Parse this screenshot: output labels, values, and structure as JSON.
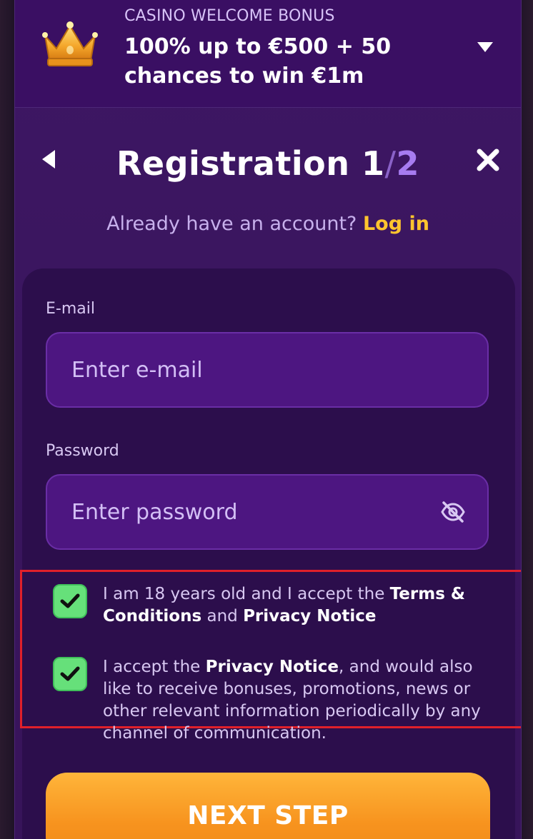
{
  "bonus": {
    "kicker": "CASINO WELCOME BONUS",
    "title": "100% up to €500 + 50 chances to win €1m",
    "toggle_icon": "caret-down-icon",
    "crown_icon": "crown-icon"
  },
  "registration": {
    "title_word": "Registration",
    "step_current": "1",
    "step_separator": "/",
    "step_total": "2",
    "already_text": "Already have an account?",
    "login_link": "Log in"
  },
  "form": {
    "email_label": "E-mail",
    "email_placeholder": "Enter e-mail",
    "email_value": "",
    "password_label": "Password",
    "password_placeholder": "Enter password",
    "password_value": ""
  },
  "consents": [
    {
      "checked": true,
      "parts": {
        "a": "I am 18 years old and I accept the",
        "b": "Terms & Conditions",
        "c": "and",
        "d": "Privacy Notice"
      }
    },
    {
      "checked": true,
      "parts": {
        "a": "I accept the",
        "b": "Privacy Notice",
        "c": ", and would also like to receive bonuses, promotions, news or other relevant information periodically by any channel of communication."
      }
    }
  ],
  "actions": {
    "next_label": "NEXT STEP"
  },
  "colors": {
    "accent": "#ffc42e",
    "button_orange": "#f7931e",
    "checkbox_green": "#66e07a",
    "highlight_red": "#e0202a"
  }
}
